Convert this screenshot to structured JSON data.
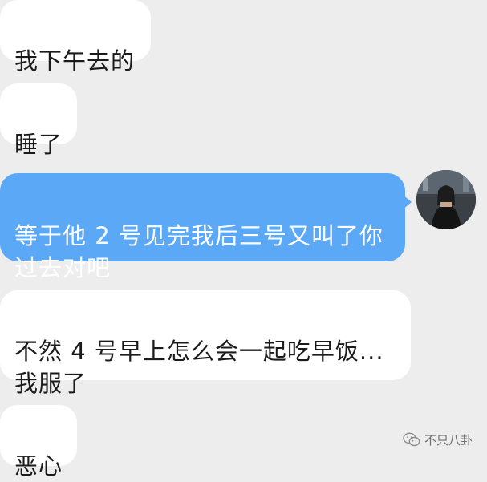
{
  "messages": [
    {
      "side": "received",
      "text": "我下午去的"
    },
    {
      "side": "received",
      "text": "睡了"
    },
    {
      "side": "sent",
      "text": "等于他 2 号见完我后三号又叫了你\n过去对吧"
    },
    {
      "side": "received",
      "text": "不然 4 号早上怎么会一起吃早饭...\n我服了"
    },
    {
      "side": "received",
      "text": "恶心"
    }
  ],
  "watermark": {
    "text": "不只八卦",
    "icon": "wechat-icon"
  },
  "colors": {
    "background": "#ededed",
    "received_bubble": "#ffffff",
    "sent_bubble": "#5aa8f6",
    "sent_text": "#ffffff"
  }
}
